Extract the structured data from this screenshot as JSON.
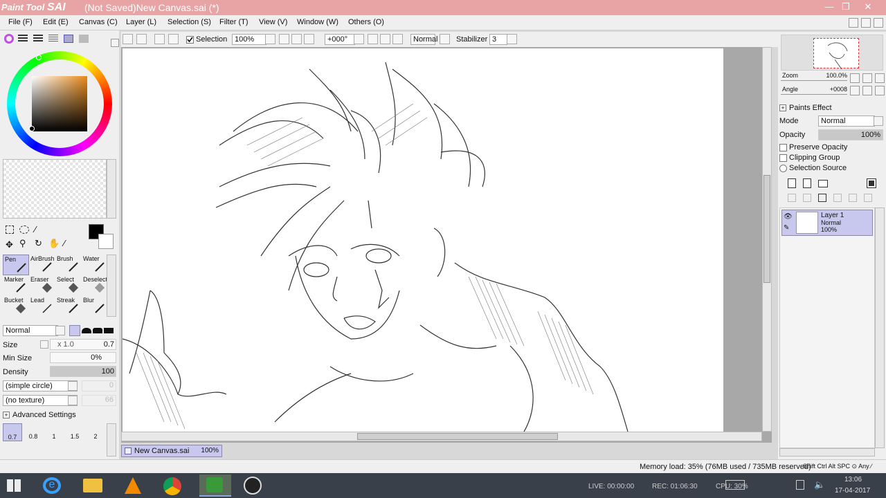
{
  "titlebar": {
    "app_logo_text": "Paint Tool",
    "app_logo_sai": "SAI",
    "title": "(Not Saved)New Canvas.sai (*)",
    "controls": {
      "minimize": "—",
      "maximize": "❐",
      "close": "✕"
    }
  },
  "menu": {
    "items": [
      "File (F)",
      "Edit (E)",
      "Canvas (C)",
      "Layer (L)",
      "Selection (S)",
      "Filter (T)",
      "View (V)",
      "Window (W)",
      "Others (O)"
    ]
  },
  "toolbar": {
    "selection_label": "Selection",
    "zoom_value": "100%",
    "angle_value": "+000°",
    "blend_mode": "Normal",
    "stabilizer_label": "Stabilizer",
    "stabilizer_value": "3"
  },
  "tools": {
    "row1": [
      "Pen",
      "AirBrush",
      "Brush",
      "Water"
    ],
    "row2": [
      "Marker",
      "Eraser",
      "Select",
      "Deselect"
    ],
    "row3": [
      "Bucket",
      "Lead",
      "Streak",
      "Blur"
    ]
  },
  "brush": {
    "mode": "Normal",
    "size_label": "Size",
    "size_multiplier": "x 1.0",
    "size_value": "0.7",
    "min_size_label": "Min Size",
    "min_size_value": "0%",
    "density_label": "Density",
    "density_value": "100",
    "shape": "(simple circle)",
    "shape_value": "0",
    "texture": "(no texture)",
    "texture_value": "66",
    "advanced_label": "Advanced Settings",
    "sizes": [
      "0.7",
      "0.8",
      "1",
      "1.5",
      "2"
    ]
  },
  "canvas_tab": {
    "name": "New Canvas.sai",
    "zoom": "100%"
  },
  "navigator": {
    "zoom_label": "Zoom",
    "zoom_value": "100.0%",
    "angle_label": "Angle",
    "angle_value": "+0008"
  },
  "layer_props": {
    "paints_effect": "Paints Effect",
    "mode_label": "Mode",
    "mode_value": "Normal",
    "opacity_label": "Opacity",
    "opacity_value": "100%",
    "preserve_opacity": "Preserve Opacity",
    "clipping_group": "Clipping Group",
    "selection_source": "Selection Source"
  },
  "layers": [
    {
      "name": "Layer 1",
      "mode": "Normal",
      "opacity": "100%"
    }
  ],
  "status": {
    "memory": "Memory load: 35% (76MB used / 735MB reserved)",
    "keys": "Shift Ctrl Alt SPC ⊙ Any ⁄"
  },
  "taskbar": {
    "live": "LIVE: 00:00:00",
    "rec": "REC: 01:06:30",
    "cpu": "CPU: 30%",
    "time": "13:06",
    "date": "17-04-2017"
  }
}
